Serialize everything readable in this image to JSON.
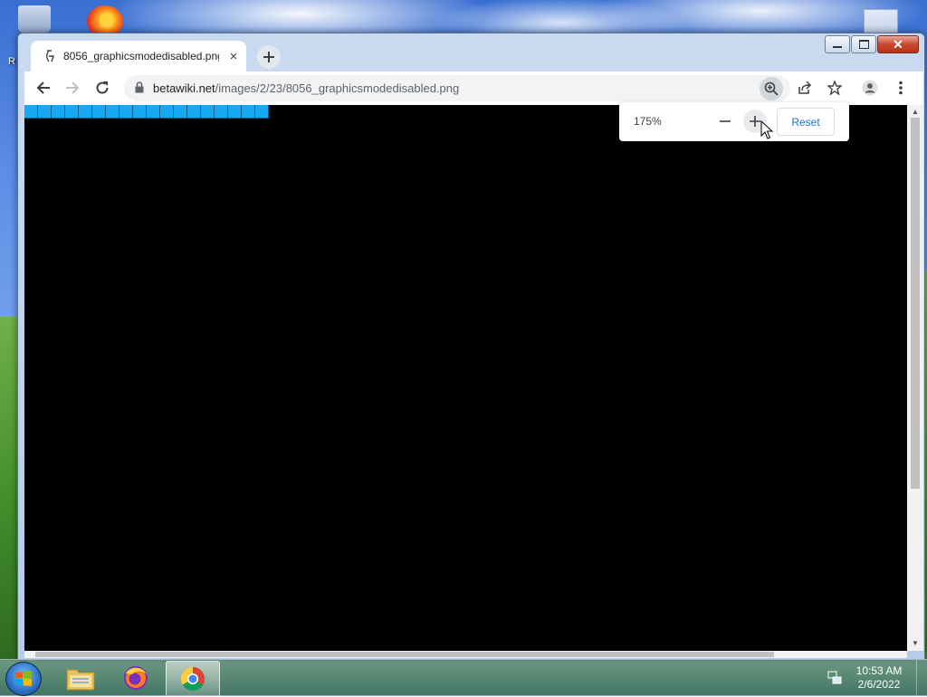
{
  "desktop": {
    "left_label": "R"
  },
  "browser": {
    "tab": {
      "title": "8056_graphicsmodedisabled.png",
      "close_symbol": "×"
    },
    "new_tab_symbol": "+",
    "address": {
      "host": "betawiki.net",
      "path": "/images/2/23/8056_graphicsmodedisabled.png"
    },
    "zoom_bubble": {
      "level": "175%",
      "reset_label": "Reset"
    },
    "content": {
      "background_color": "#000000",
      "block_color": "#16a8f0",
      "block_count": 18
    },
    "icons": [
      "back-arrow-icon",
      "forward-arrow-icon",
      "reload-icon",
      "lock-icon",
      "zoom-icon",
      "share-icon",
      "star-icon",
      "profile-icon",
      "menu-icon"
    ]
  },
  "window_controls": {
    "close_symbol": "✕"
  },
  "taskbar": {
    "apps": [
      "windows-explorer",
      "firefox",
      "chrome"
    ],
    "clock": {
      "time": "10:53 AM",
      "date": "2/6/2022"
    }
  }
}
